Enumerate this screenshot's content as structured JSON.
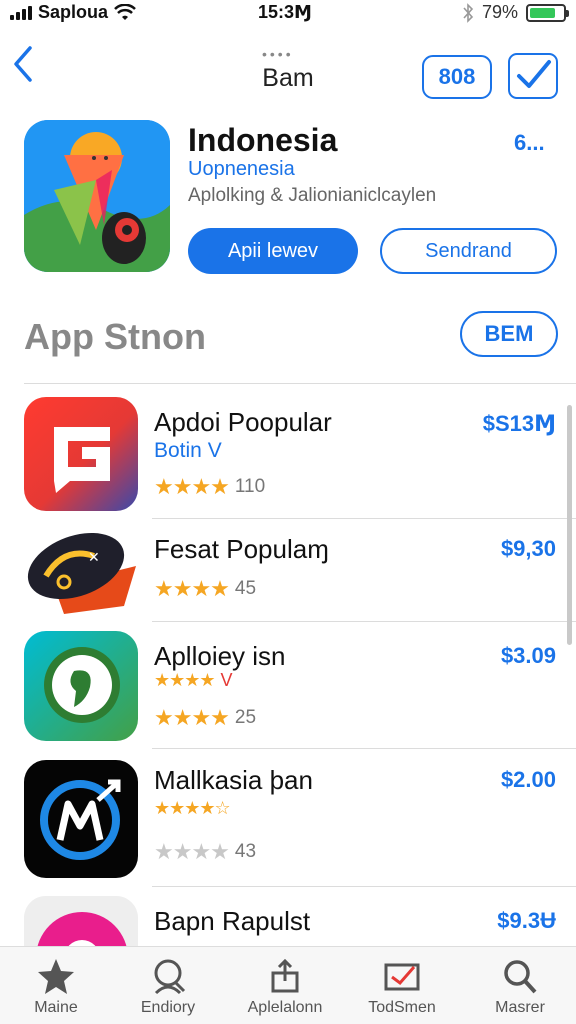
{
  "status": {
    "carrier": "Saploua",
    "time": "15:3Ɱ",
    "battery": "79%",
    "battery_level": 0.79
  },
  "nav": {
    "dots": "••••",
    "title": "Bam",
    "count": "808",
    "icons": {
      "back": "chevron-left-icon",
      "check": "checkbox-check-icon"
    }
  },
  "featured": {
    "title": "Indonesia",
    "more": "6...",
    "subtitle": "Uopnenesia",
    "description": "Aplolking & Jalionianiclcaylen",
    "primary_button": "Apii lewev",
    "secondary_button": "Sendrand"
  },
  "section": {
    "title": "App Stnon",
    "button": "BEM"
  },
  "apps": [
    {
      "name": "Apdoi Poopular",
      "price": "$S13Ɱ",
      "subtitle": "Botin V",
      "rating": "110",
      "stars": 4,
      "icon": "g-app-icon"
    },
    {
      "name": "Fesat Populaɱ",
      "price": "$9,30",
      "rating": "45",
      "stars": 4,
      "icon": "dark-mask-app-icon"
    },
    {
      "name": "Aplloiey isn",
      "price": "$3.09",
      "sub_stars_suffix": "V",
      "rating": "25",
      "stars": 4,
      "icon": "green-chat-app-icon"
    },
    {
      "name": "Mallkasia þan",
      "price": "$2.00",
      "rating": "43",
      "stars": 4,
      "icon": "blue-m-app-icon"
    },
    {
      "name": "Bapn Rapulst",
      "price": "$9.3Ʉ",
      "icon": "pink-app-icon"
    }
  ],
  "tabs": [
    {
      "label": "Maine",
      "icon": "star-icon"
    },
    {
      "label": "Endiory",
      "icon": "search-person-icon"
    },
    {
      "label": "Aplelalonn",
      "icon": "apps-upload-icon"
    },
    {
      "label": "TodSmen",
      "icon": "inbox-icon"
    },
    {
      "label": "Masrer",
      "icon": "search-icon"
    }
  ]
}
